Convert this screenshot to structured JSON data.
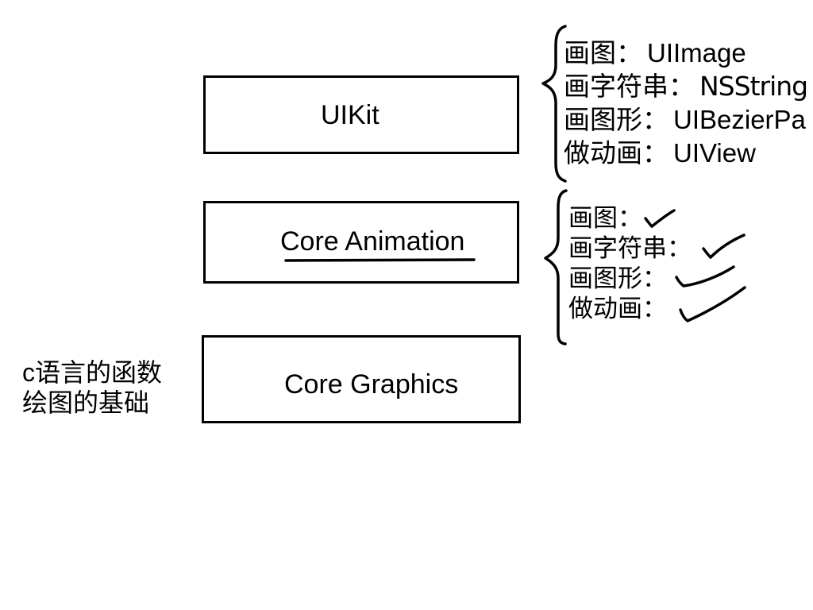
{
  "layers": [
    {
      "name": "UIKit"
    },
    {
      "name": "Core Animation"
    },
    {
      "name": "Core Graphics"
    }
  ],
  "core_graphics_note": [
    "c语言的函数",
    "绘图的基础"
  ],
  "uikit_items": [
    {
      "label": "画图：",
      "value": "UIImage"
    },
    {
      "label": "画字符串：",
      "value": "NSString"
    },
    {
      "label": "画图形：",
      "value": "UIBezierPa"
    },
    {
      "label": "做动画：",
      "value": "UIView"
    }
  ],
  "core_animation_items": [
    {
      "label": "画图："
    },
    {
      "label": "画字符串："
    },
    {
      "label": "画图形："
    },
    {
      "label": "做动画："
    }
  ]
}
